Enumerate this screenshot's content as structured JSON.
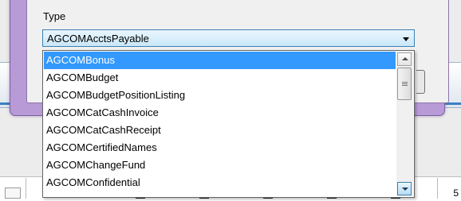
{
  "dialog": {
    "type_label": "Type",
    "type_combo": {
      "value": "AGCOMAcctsPayable"
    },
    "dropdown": {
      "items": [
        "AGCOMBonus",
        "AGCOMBudget",
        "AGCOMBudgetPositionListing",
        "AGCOMCatCashInvoice",
        "AGCOMCatCashReceipt",
        "AGCOMCertifiedNames",
        "AGCOMChangeFund",
        "AGCOMConfidential"
      ],
      "selected_index": 0
    }
  },
  "background": {
    "page_number_fragment": "5"
  },
  "colors": {
    "selection": "#3399ff",
    "dialog_frame": "#b79ad6",
    "combo_border": "#3c7fb1"
  }
}
